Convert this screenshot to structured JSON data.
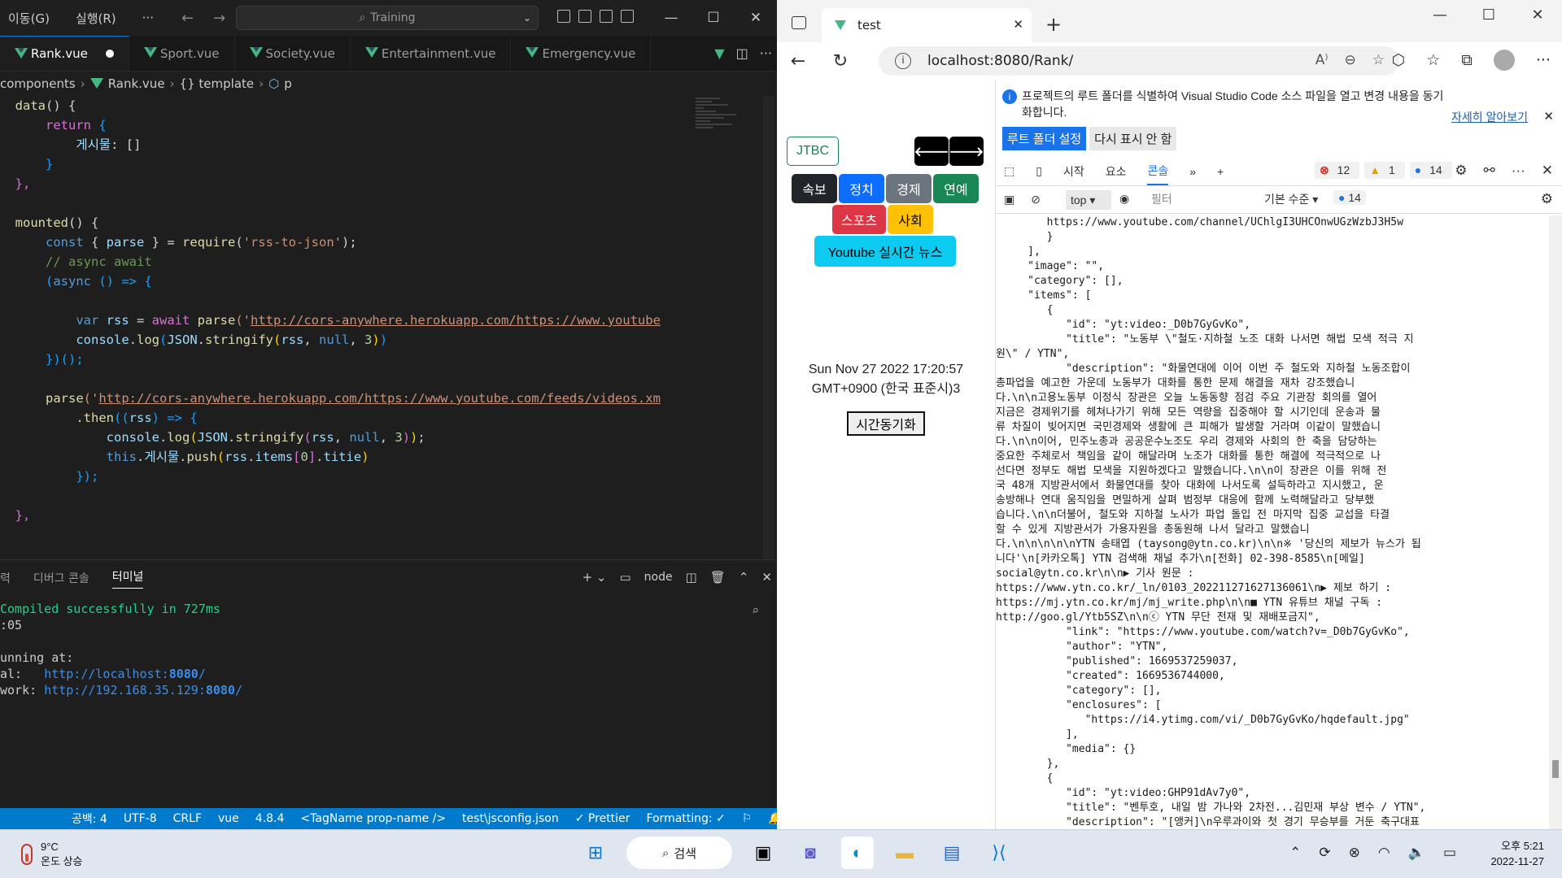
{
  "vscode": {
    "menu": [
      "이동(G)",
      "실행(R)",
      "···"
    ],
    "search": "Training",
    "tabs": [
      {
        "label": "Rank.vue",
        "active": true
      },
      {
        "label": "Sport.vue"
      },
      {
        "label": "Society.vue"
      },
      {
        "label": "Entertainment.vue"
      },
      {
        "label": "Emergency.vue"
      }
    ],
    "breadcrumb": [
      "components",
      "Rank.vue",
      "{} template",
      "p"
    ],
    "code": {
      "l1a": "data",
      "l1b": "() {",
      "l2a": "return",
      "l2b": " {",
      "l3a": "게시물",
      "l3b": ": []",
      "l4": "}",
      "l5": "},",
      "l7a": "mounted",
      "l7b": "() {",
      "l8a": "const",
      "l8b": " { ",
      "l8c": "parse",
      "l8d": " } = ",
      "l8e": "require",
      "l8f": "(",
      "l8g": "'rss-to-json'",
      "l8h": ");",
      "l9": "// async await",
      "l10a": "(",
      "l10b": "async",
      "l10c": " () => {",
      "l12a": "var",
      "l12b": " rss",
      "l12c": " = ",
      "l12d": "await",
      "l12e": "parse",
      "l12f": "('",
      "l12g": "http://cors-anywhere.herokuapp.com/https://www.youtube",
      "l13a": "console",
      "l13b": ".",
      "l13c": "log",
      "l13d": "(",
      "l13e": "JSON",
      "l13f": "stringify",
      "l13g": "rss",
      "l13h": "null",
      "l13i": "3",
      "l14": "})();",
      "l16a": "parse",
      "l16b": "('",
      "l16c": "http://cors-anywhere.herokuapp.com/https://www.youtube.com/feeds/videos.xm",
      "l17a": ".then",
      "l17b": "((",
      "l17c": "rss",
      "l17d": ") => {",
      "l18a": "console",
      "l18b": "log",
      "l18c": "JSON",
      "l18d": "stringify",
      "l18e": "rss",
      "l18f": "null",
      "l18g": "3",
      "l19a": "this",
      "l19b": "게시물",
      "l19c": "push",
      "l19d": "rss",
      "l19e": "items",
      "l19f": "0",
      "l19g": "titie",
      "l20": "});",
      "l22": "},"
    },
    "panel_tabs": [
      "력",
      "디버그 콘솔",
      "터미널"
    ],
    "panel_node": "node",
    "terminal": {
      "compiled": "Compiled successfully in 727ms",
      "time": ":05",
      "running": "unning at:",
      "local_label": "al:",
      "local_url": "http://localhost:",
      "local_port": "8080",
      "network_label": "work:",
      "network_url": "http://192.168.35.129:",
      "network_port": "8080"
    },
    "status": [
      "공백: 4",
      "UTF-8",
      "CRLF",
      "vue",
      "4.8.4",
      "<TagName prop-name />",
      "test\\jsconfig.json",
      "✓ Prettier",
      "Formatting: ✓"
    ]
  },
  "browser": {
    "tab_title": "test",
    "url": "localhost:8080/Rank/",
    "page": {
      "jtbc": "JTBC",
      "left_arrow": "🡐",
      "right_arrow": "🡒",
      "categories": [
        {
          "label": "속보",
          "color": "#212529"
        },
        {
          "label": "정치",
          "color": "#0d6efd"
        },
        {
          "label": "경제",
          "color": "#6c757d"
        },
        {
          "label": "연예",
          "color": "#198754"
        },
        {
          "label": "스포츠",
          "color": "#dc3545"
        },
        {
          "label": "사회",
          "color": "#ffc107"
        }
      ],
      "youtube": "Youtube 실시간 뉴스",
      "datetime_1": "Sun Nov 27 2022 17:20:57",
      "datetime_2": "GMT+0900 (한국 표준시)3",
      "sync": "시간동기화"
    },
    "devtools": {
      "info": "프로젝트의 루트 폴더를 식별하여 Visual Studio Code 소스 파일을 열고 변경 내용을 동기화합니다.",
      "learn_more": "자세히 알아보기",
      "set_root": "루트 폴더 설정",
      "dont_show": "다시 표시 안 함",
      "tabs": [
        "시작",
        "요소",
        "콘솔"
      ],
      "errors": "12",
      "warnings": "1",
      "messages": "14",
      "context": "top",
      "filter_placeholder": "필터",
      "level": "기본 수준",
      "filter_count": "14",
      "console_lines": [
        "        https://www.youtube.com/channel/UChlgI3UHCOnwUGzWzbJ3H5w",
        "        }",
        "     ],",
        "     \"image\": \"\",",
        "     \"category\": [],",
        "     \"items\": [",
        "        {",
        "           \"id\": \"yt:video:_D0b7GyGvKo\",",
        "           \"title\": \"노동부 \\\"철도·지하철 노조 대화 나서면 해법 모색 적극 지",
        "원\\\" / YTN\",",
        "           \"description\": \"화물연대에 이어 이번 주 철도와 지하철 노동조합이",
        "총파업을 예고한 가운데 노동부가 대화를 통한 문제 해결을 재차 강조했습니",
        "다.\\n\\n고용노동부 이정식 장관은 오늘 노동동향 점검 주요 기관장 회의를 열어",
        "지금은 경제위기를 헤쳐나가기 위해 모든 역량을 집중해야 할 시기인데 운송과 물",
        "류 차질이 빚어지면 국민경제와 생활에 큰 피해가 발생할 거라며 이같이 말했습니",
        "다.\\n\\n이어, 민주노총과 공공운수노조도 우리 경제와 사회의 한 축을 담당하는",
        "중요한 주체로서 책임을 같이 해달라며 노조가 대화를 통한 해결에 적극적으로 나",
        "선다면 정부도 해법 모색을 지원하겠다고 말했습니다.\\n\\n이 장관은 이를 위해 전",
        "국 48개 지방관서에서 화물연대를 찾아 대화에 나서도록 설득하라고 지시했고, 운",
        "송방해나 연대 움직임을 면밀하게 살펴 범정부 대응에 함께 노력해달라고 당부했",
        "습니다.\\n\\n더불어, 철도와 지하철 노사가 파업 돌입 전 마지막 집중 교섭을 타결",
        "할 수 있게 지방관서가 가용자원을 총동원해 나서 달라고 말했습니",
        "다.\\n\\n\\n\\n\\nYTN 송태엽 (taysong@ytn.co.kr)\\n\\n※ '당신의 제보가 뉴스가 됩",
        "니다'\\n[카카오톡] YTN 검색해 채널 추가\\n[전화] 02-398-8585\\n[메일]",
        "social@ytn.co.kr\\n\\n▶ 기사 원문 :",
        "https://www.ytn.co.kr/_ln/0103_202211271627136061\\n▶ 제보 하기 :",
        "https://mj.ytn.co.kr/mj/mj_write.php\\n\\n■ YTN 유튜브 채널 구독 :",
        "http://goo.gl/Ytb5SZ\\n\\nⓒ YTN 무단 전재 및 재배포금지\",",
        "           \"link\": \"https://www.youtube.com/watch?v=_D0b7GyGvKo\",",
        "           \"author\": \"YTN\",",
        "           \"published\": 1669537259037,",
        "           \"created\": 1669536744000,",
        "           \"category\": [],",
        "           \"enclosures\": [",
        "              \"https://i4.ytimg.com/vi/_D0b7GyGvKo/hqdefault.jpg\"",
        "           ],",
        "           \"media\": {}",
        "        },",
        "        {",
        "           \"id\": \"yt:video:GHP91dAv7y0\",",
        "           \"title\": \"벤투호, 내일 밤 가나와 2차전...김민재 부상 변수 / YTN\",",
        "           \"description\": \"[앵커]\\n우루과이와 첫 경기 무승부를 거둔 축구대표"
      ]
    }
  },
  "taskbar": {
    "temperature": "9°C",
    "weather": "온도 상승",
    "search": "검색",
    "time": "오후 5:21",
    "date": "2022-11-27"
  }
}
